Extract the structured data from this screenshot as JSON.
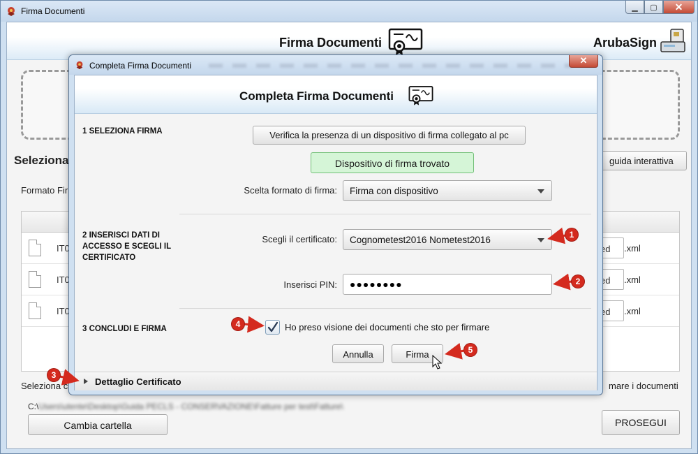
{
  "window": {
    "title": "Firma Documenti"
  },
  "main": {
    "header_title": "Firma Documenti",
    "brand": "ArubaSign",
    "section_heading": "Seleziona",
    "guide_button": "guida interattiva",
    "formato_label": "Formato Fir",
    "files": [
      {
        "code": "IT0",
        "name_fragment": "ed",
        "ext": ".xml"
      },
      {
        "code": "IT0",
        "name_fragment": "ed",
        "ext": ".xml"
      },
      {
        "code": "IT0",
        "name_fragment": "ed",
        "ext": ".xml"
      }
    ],
    "select_folder_text": "Seleziona c",
    "firmare_docs_text": "mare i documenti",
    "path_prefix": "C:\\",
    "path_blurred": "Users\\utente\\Desktop\\Guida PECLS - CONSERVAZIONE\\Fatture per test\\Fatture\\",
    "change_folder_button": "Cambia cartella",
    "continue_button": "PROSEGUI"
  },
  "dialog": {
    "title": "Completa Firma Documenti",
    "header_title": "Completa Firma Documenti",
    "step1_label": "1 SELEZIONA FIRMA",
    "verify_button": "Verifica la presenza di un dispositivo di firma collegato al pc",
    "device_found": "Dispositivo di firma trovato",
    "format_label": "Scelta formato di firma:",
    "format_value": "Firma con dispositivo",
    "step2_label": "2 INSERISCI DATI DI ACCESSO E SCEGLI IL CERTIFICATO",
    "cert_label": "Scegli il certificato:",
    "cert_value": "Cognometest2016 Nometest2016",
    "pin_label": "Inserisci PIN:",
    "pin_value": "●●●●●●●●",
    "step3_label": "3 CONCLUDI E FIRMA",
    "checkbox_label": "Ho preso visione dei documenti che sto per firmare",
    "checkbox_checked": true,
    "cancel_button": "Annulla",
    "sign_button": "Firma",
    "detail_label": "Dettaglio Certificato"
  },
  "markers": [
    "1",
    "2",
    "3",
    "4",
    "5"
  ],
  "colors": {
    "accent_red": "#d42a1e",
    "found_green": "#d5f5d7",
    "header_blue": "#d8e9f6"
  }
}
